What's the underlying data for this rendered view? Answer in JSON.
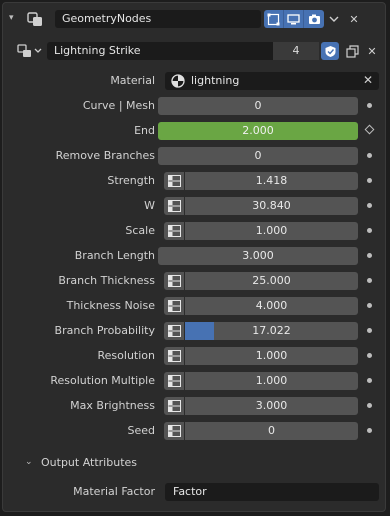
{
  "header": {
    "caret": "▾",
    "modifier_name": "GeometryNodes",
    "icons": [
      "editmode-icon",
      "viewport-icon",
      "render-icon"
    ],
    "dropdown": "⌄",
    "close": "✕"
  },
  "node_group": {
    "name": "Lightning Strike",
    "users": "4",
    "close": "✕"
  },
  "material": {
    "label": "Material",
    "value": "lightning",
    "close": "✕"
  },
  "properties": [
    {
      "key": "curve-mesh",
      "label": "Curve | Mesh",
      "value": "0",
      "attr": false,
      "green": false,
      "fill": 0,
      "marker": "dot"
    },
    {
      "key": "end",
      "label": "End",
      "value": "2.000",
      "attr": false,
      "green": true,
      "fill": 0,
      "marker": "diamond"
    },
    {
      "key": "remove-branches",
      "label": "Remove Branches",
      "value": "0",
      "attr": false,
      "green": false,
      "fill": 0,
      "marker": "dot"
    },
    {
      "key": "strength",
      "label": "Strength",
      "value": "1.418",
      "attr": true,
      "green": false,
      "fill": 0,
      "marker": "dot"
    },
    {
      "key": "w",
      "label": "W",
      "value": "30.840",
      "attr": true,
      "green": false,
      "fill": 0,
      "marker": "dot"
    },
    {
      "key": "scale",
      "label": "Scale",
      "value": "1.000",
      "attr": true,
      "green": false,
      "fill": 0,
      "marker": "dot"
    },
    {
      "key": "branch-length",
      "label": "Branch Length",
      "value": "3.000",
      "attr": false,
      "green": false,
      "fill": 0,
      "marker": "dot"
    },
    {
      "key": "branch-thickness",
      "label": "Branch Thickness",
      "value": "25.000",
      "attr": true,
      "green": false,
      "fill": 0,
      "marker": "dot"
    },
    {
      "key": "thickness-noise",
      "label": "Thickness Noise",
      "value": "4.000",
      "attr": true,
      "green": false,
      "fill": 0,
      "marker": "dot"
    },
    {
      "key": "branch-probability",
      "label": "Branch Probability",
      "value": "17.022",
      "attr": true,
      "green": false,
      "fill": 0.17022,
      "marker": "dot"
    },
    {
      "key": "resolution",
      "label": "Resolution",
      "value": "1.000",
      "attr": true,
      "green": false,
      "fill": 0,
      "marker": "dot"
    },
    {
      "key": "resolution-multiple",
      "label": "Resolution Multiple",
      "value": "1.000",
      "attr": true,
      "green": false,
      "fill": 0,
      "marker": "dot"
    },
    {
      "key": "max-brightness",
      "label": "Max Brightness",
      "value": "3.000",
      "attr": true,
      "green": false,
      "fill": 0,
      "marker": "dot"
    },
    {
      "key": "seed",
      "label": "Seed",
      "value": "0",
      "attr": true,
      "green": false,
      "fill": 0,
      "marker": "dot"
    }
  ],
  "output_section": {
    "caret": "⌄",
    "title": "Output Attributes"
  },
  "material_factor": {
    "label": "Material Factor",
    "value": "Factor"
  },
  "colors": {
    "accent": "#4772b3",
    "green": "#6aa644",
    "field": "#545454",
    "panel": "#2b2b2b"
  }
}
